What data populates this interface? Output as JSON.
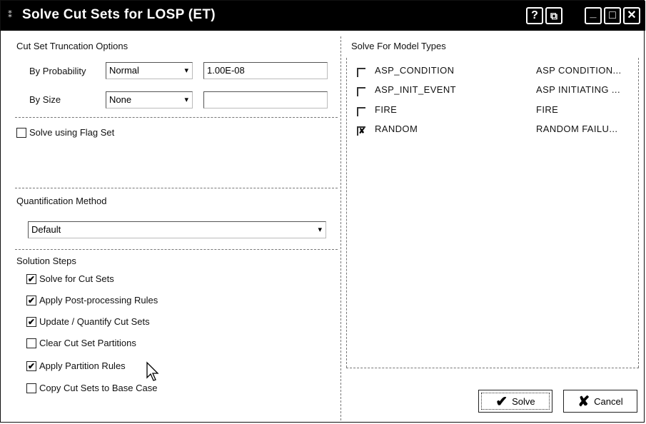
{
  "window": {
    "title": "Solve Cut Sets for LOSP (ET)",
    "sys_icon": "⁑",
    "help_icon": "?",
    "restore_icon": "⧉",
    "minimize_icon": "_",
    "maximize_icon": "□",
    "close_icon": "✕"
  },
  "truncation": {
    "heading": "Cut Set Truncation Options",
    "by_probability_label": "By Probability",
    "by_probability_value": "Normal",
    "probability_text": "1.00E-08",
    "by_size_label": "By Size",
    "by_size_value": "None",
    "size_text": ""
  },
  "flag_set": {
    "label": "Solve using Flag Set",
    "checked": false
  },
  "quantification": {
    "heading": "Quantification Method",
    "value": "Default"
  },
  "solution_steps": {
    "heading": "Solution Steps",
    "items": [
      {
        "label": "Solve for Cut Sets",
        "checked": true
      },
      {
        "label": "Apply Post-processing Rules",
        "checked": true
      },
      {
        "label": "Update / Quantify Cut Sets",
        "checked": true
      },
      {
        "label": "Clear Cut Set Partitions",
        "checked": false
      },
      {
        "label": "Apply Partition Rules",
        "checked": true
      },
      {
        "label": "Copy Cut Sets to Base Case",
        "checked": false
      }
    ]
  },
  "model_types": {
    "heading": "Solve For Model Types",
    "rows": [
      {
        "name": "ASP_CONDITION",
        "desc": "ASP CONDITION...",
        "checked": false
      },
      {
        "name": "ASP_INIT_EVENT",
        "desc": "ASP INITIATING ...",
        "checked": false
      },
      {
        "name": "FIRE",
        "desc": "FIRE",
        "checked": false
      },
      {
        "name": "RANDOM",
        "desc": "RANDOM FAILU...",
        "checked": true
      }
    ]
  },
  "buttons": {
    "solve": "Solve",
    "cancel": "Cancel"
  },
  "icons": {
    "check": "✔",
    "x_mark": "✘",
    "arrow": "▾"
  },
  "colors": {
    "titlebar": "#000000",
    "cancel_x": "#111111"
  }
}
